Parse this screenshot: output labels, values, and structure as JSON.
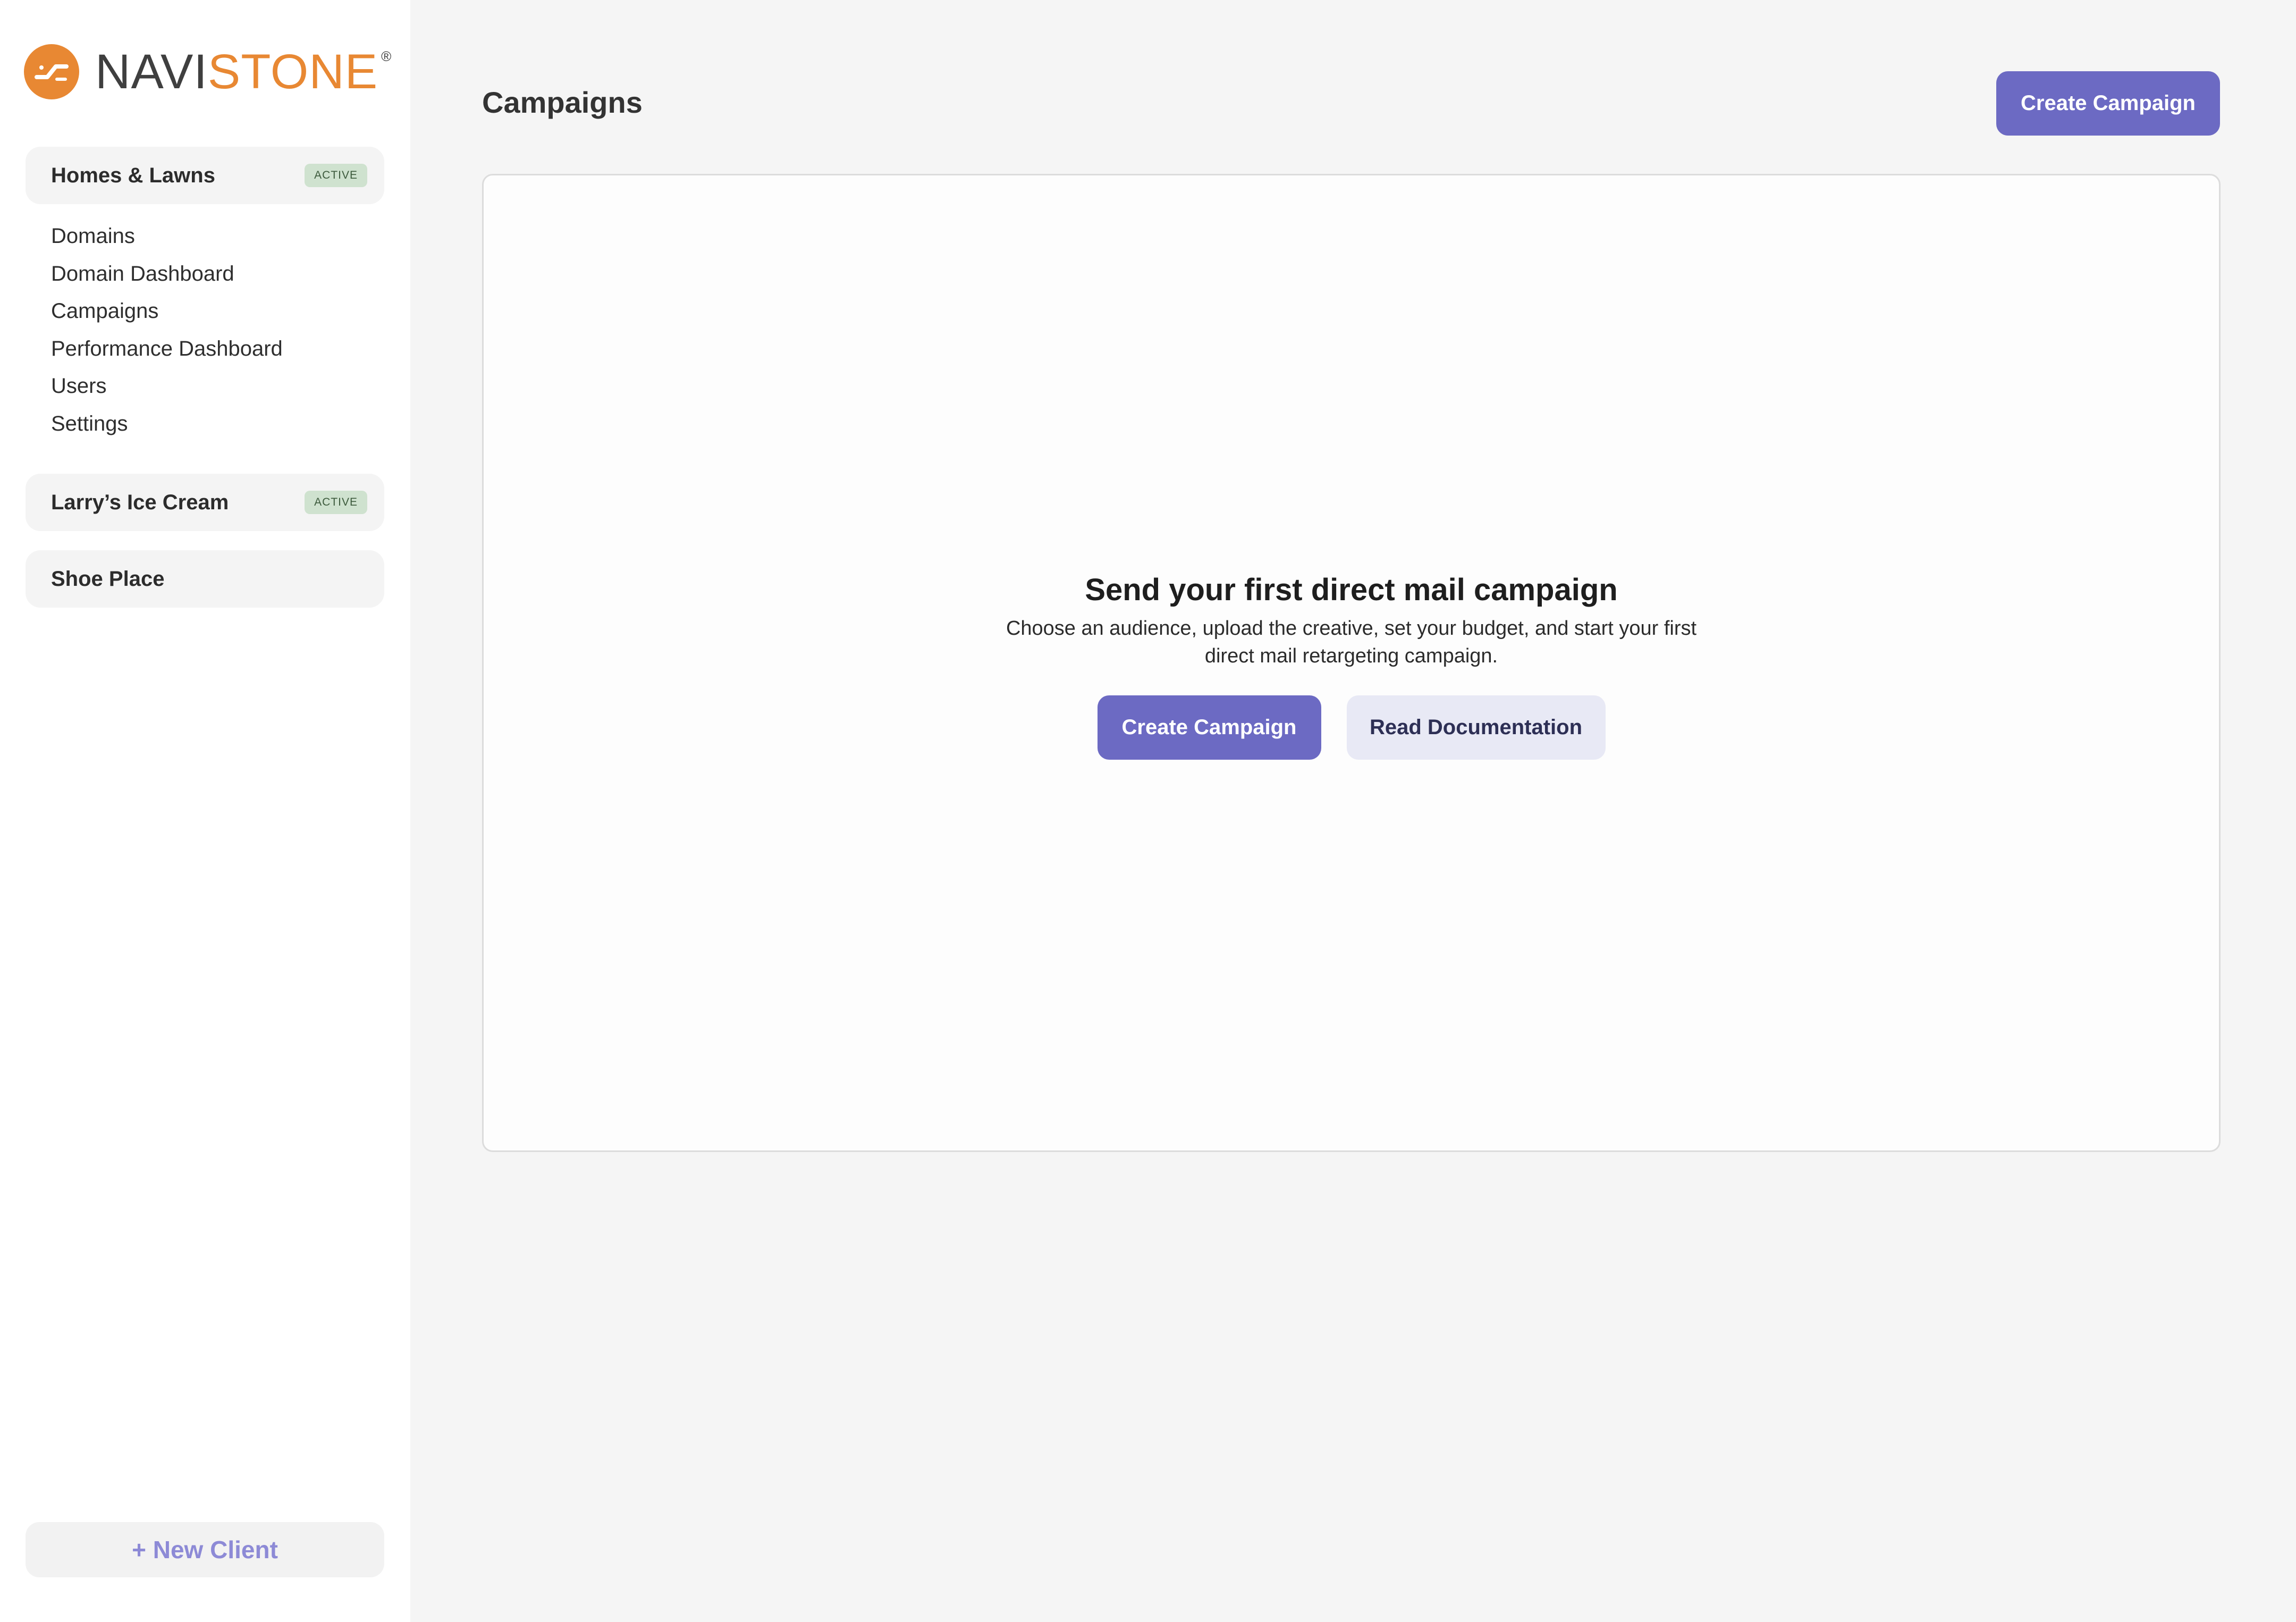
{
  "brand": {
    "name_part1": "NAVI",
    "name_part2": "STONE",
    "registered": "®",
    "logo_icon": "navistone-logo-icon",
    "colors": {
      "orange": "#e88833",
      "dark": "#3f3f3f"
    }
  },
  "sidebar": {
    "clients": [
      {
        "name": "Homes & Lawns",
        "badge": "ACTIVE"
      },
      {
        "name": "Larry’s Ice Cream",
        "badge": "ACTIVE"
      },
      {
        "name": "Shoe Place"
      }
    ],
    "nav_items": [
      {
        "label": "Domains"
      },
      {
        "label": "Domain Dashboard"
      },
      {
        "label": "Campaigns"
      },
      {
        "label": "Performance Dashboard"
      },
      {
        "label": "Users"
      },
      {
        "label": "Settings"
      }
    ],
    "new_client_label": "+ New Client"
  },
  "main": {
    "title": "Campaigns",
    "header_button": "Create Campaign",
    "empty_state": {
      "title": "Send your first direct mail campaign",
      "description": "Choose an audience, upload the creative, set your budget, and start your first direct mail retargeting campaign.",
      "primary_button": "Create Campaign",
      "secondary_button": "Read Documentation"
    }
  },
  "colors": {
    "accent": "#6c6ac3",
    "secondary_button_bg": "#e8e9f5",
    "badge_bg": "#cfe2cf",
    "new_client_text": "#8d8ad6"
  }
}
